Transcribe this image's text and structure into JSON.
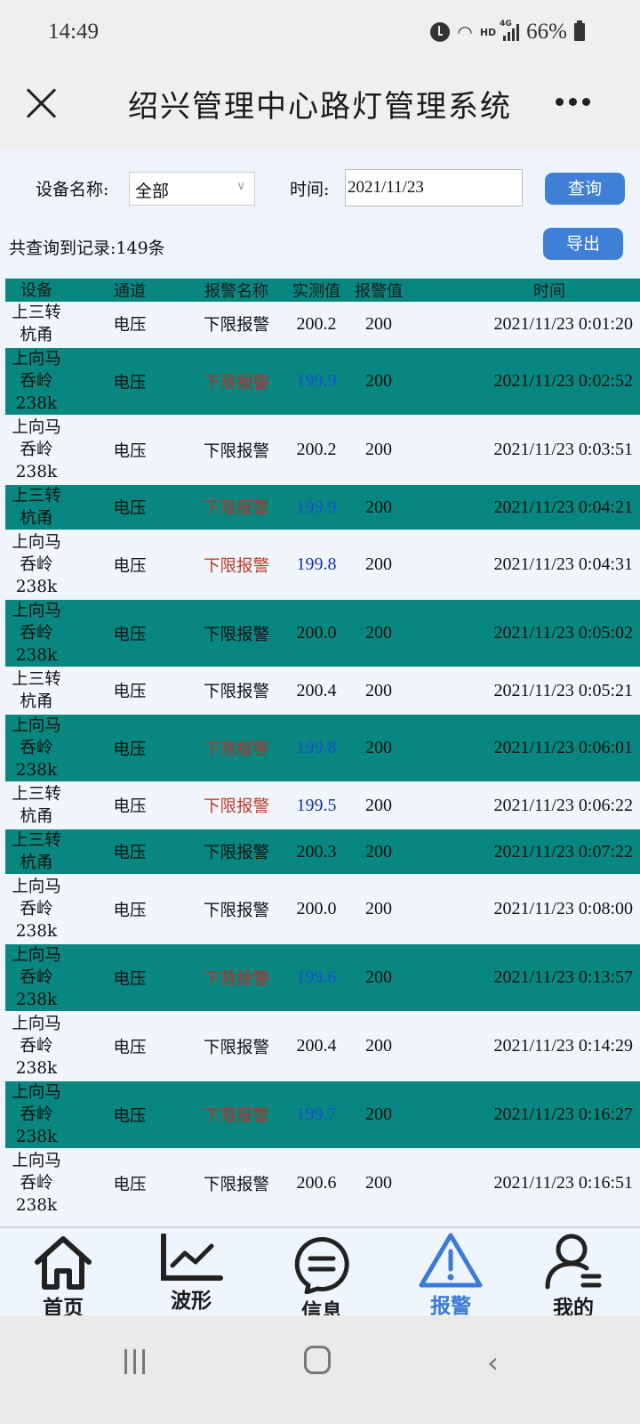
{
  "status_bar": {
    "time": "14:49",
    "icons": [
      "alarm-icon",
      "wifi-icon",
      "hd-icon",
      "4g-signal-icon",
      "battery-icon"
    ],
    "hd_label": "HD",
    "network_label": "4G",
    "battery": "66%"
  },
  "header": {
    "title": "绍兴管理中心路灯管理系统",
    "close_icon": "close-icon",
    "more_icon": "more-icon"
  },
  "filters": {
    "device_label": "设备名称:",
    "device_value": "全部",
    "time_label": "时间:",
    "time_value": "2021/11/23",
    "query_button": "查询"
  },
  "summary": {
    "text": "共查询到记录:149条",
    "export_button": "导出"
  },
  "colors": {
    "teal_row": "#07877f",
    "light_row": "#f1f6fb",
    "accent_blue": "#3f7fd6",
    "alarm_red": "#c0392b",
    "value_blue": "#1530a8"
  },
  "table": {
    "headers": [
      "设备",
      "通道",
      "报警名称",
      "实测值",
      "报警值",
      "时间"
    ],
    "rows": [
      {
        "device": [
          "上三转",
          "杭甬"
        ],
        "channel": "电压",
        "alarm": "下限报警",
        "measured": "200.2",
        "threshold": "200",
        "time": "2021/11/23 0:01:20",
        "style": "light",
        "highlight": false
      },
      {
        "device": [
          "上向马",
          "呑岭",
          "238k"
        ],
        "channel": "电压",
        "alarm": "下限报警",
        "measured": "199.9",
        "threshold": "200",
        "time": "2021/11/23 0:02:52",
        "style": "teal",
        "highlight": true
      },
      {
        "device": [
          "上向马",
          "呑岭",
          "238k"
        ],
        "channel": "电压",
        "alarm": "下限报警",
        "measured": "200.2",
        "threshold": "200",
        "time": "2021/11/23 0:03:51",
        "style": "light",
        "highlight": false
      },
      {
        "device": [
          "上三转",
          "杭甬"
        ],
        "channel": "电压",
        "alarm": "下限报警",
        "measured": "199.9",
        "threshold": "200",
        "time": "2021/11/23 0:04:21",
        "style": "teal",
        "highlight": true
      },
      {
        "device": [
          "上向马",
          "呑岭",
          "238k"
        ],
        "channel": "电压",
        "alarm": "下限报警",
        "measured": "199.8",
        "threshold": "200",
        "time": "2021/11/23 0:04:31",
        "style": "light",
        "highlight": true
      },
      {
        "device": [
          "上向马",
          "呑岭",
          "238k"
        ],
        "channel": "电压",
        "alarm": "下限报警",
        "measured": "200.0",
        "threshold": "200",
        "time": "2021/11/23 0:05:02",
        "style": "teal",
        "highlight": false
      },
      {
        "device": [
          "上三转",
          "杭甬"
        ],
        "channel": "电压",
        "alarm": "下限报警",
        "measured": "200.4",
        "threshold": "200",
        "time": "2021/11/23 0:05:21",
        "style": "light",
        "highlight": false
      },
      {
        "device": [
          "上向马",
          "呑岭",
          "238k"
        ],
        "channel": "电压",
        "alarm": "下限报警",
        "measured": "199.8",
        "threshold": "200",
        "time": "2021/11/23 0:06:01",
        "style": "teal",
        "highlight": true
      },
      {
        "device": [
          "上三转",
          "杭甬"
        ],
        "channel": "电压",
        "alarm": "下限报警",
        "measured": "199.5",
        "threshold": "200",
        "time": "2021/11/23 0:06:22",
        "style": "light",
        "highlight": true
      },
      {
        "device": [
          "上三转",
          "杭甬"
        ],
        "channel": "电压",
        "alarm": "下限报警",
        "measured": "200.3",
        "threshold": "200",
        "time": "2021/11/23 0:07:22",
        "style": "teal",
        "highlight": false
      },
      {
        "device": [
          "上向马",
          "呑岭",
          "238k"
        ],
        "channel": "电压",
        "alarm": "下限报警",
        "measured": "200.0",
        "threshold": "200",
        "time": "2021/11/23 0:08:00",
        "style": "light",
        "highlight": false
      },
      {
        "device": [
          "上向马",
          "呑岭",
          "238k"
        ],
        "channel": "电压",
        "alarm": "下限报警",
        "measured": "199.6",
        "threshold": "200",
        "time": "2021/11/23 0:13:57",
        "style": "teal",
        "highlight": true
      },
      {
        "device": [
          "上向马",
          "呑岭",
          "238k"
        ],
        "channel": "电压",
        "alarm": "下限报警",
        "measured": "200.4",
        "threshold": "200",
        "time": "2021/11/23 0:14:29",
        "style": "light",
        "highlight": false
      },
      {
        "device": [
          "上向马",
          "呑岭",
          "238k"
        ],
        "channel": "电压",
        "alarm": "下限报警",
        "measured": "199.7",
        "threshold": "200",
        "time": "2021/11/23 0:16:27",
        "style": "teal",
        "highlight": true
      },
      {
        "device": [
          "上向马",
          "呑岭",
          "238k"
        ],
        "channel": "电压",
        "alarm": "下限报警",
        "measured": "200.6",
        "threshold": "200",
        "time": "2021/11/23 0:16:51",
        "style": "light",
        "highlight": false
      }
    ]
  },
  "tabbar": {
    "active": 3,
    "items": [
      {
        "label": "首页",
        "icon": "home-icon"
      },
      {
        "label": "波形",
        "icon": "waveform-chart-icon"
      },
      {
        "label": "信息",
        "icon": "message-bubble-icon"
      },
      {
        "label": "报警",
        "icon": "warning-triangle-icon"
      },
      {
        "label": "我的",
        "icon": "user-profile-icon"
      }
    ]
  },
  "navbar": {
    "icons": [
      "recent-apps-icon",
      "home-nav-icon",
      "back-icon"
    ]
  }
}
